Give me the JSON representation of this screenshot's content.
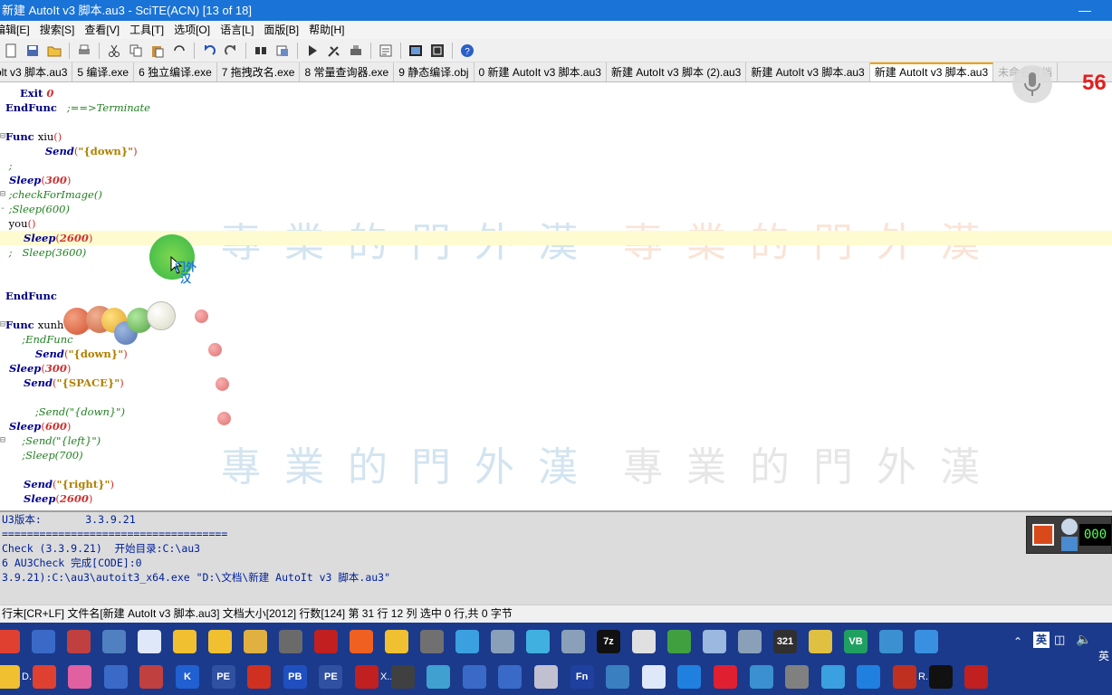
{
  "window": {
    "title": "新建 AutoIt v3 脚本.au3 - SciTE(ACN) [13 of 18]",
    "minimize_icon": "minimize-icon"
  },
  "menu": [
    "编辑[E]",
    "搜索[S]",
    "查看[V]",
    "工具[T]",
    "选项[O]",
    "语言[L]",
    "面版[B]",
    "帮助[H]"
  ],
  "toolbar_icons": [
    "new-icon",
    "save-all-icon",
    "open-icon",
    "print-icon",
    "cut-icon",
    "copy-icon",
    "paste-icon",
    "delete-icon",
    "undo-icon",
    "redo-icon",
    "find-icon",
    "replace-icon",
    "run-icon",
    "compile-icon",
    "build-icon",
    "abbrev-icon",
    "fullscreen-icon",
    "window-icon",
    "help-icon"
  ],
  "tabs": [
    {
      "label": "olt v3 脚本.au3",
      "active": false
    },
    {
      "label": "5 编译.exe",
      "active": false
    },
    {
      "label": "6 独立编译.exe",
      "active": false
    },
    {
      "label": "7 拖拽改名.exe",
      "active": false
    },
    {
      "label": "8 常量查询器.exe",
      "active": false
    },
    {
      "label": "9 静态编译.obj",
      "active": false
    },
    {
      "label": "0 新建 AutoIt v3 脚本.au3",
      "active": false
    },
    {
      "label": "新建 AutoIt v3 脚本 (2).au3",
      "active": false
    },
    {
      "label": "新建 AutoIt v3 脚本.au3",
      "active": false
    },
    {
      "label": "新建 AutoIt v3 脚本.au3",
      "active": true
    },
    {
      "label": "未命名文档",
      "active": false
    }
  ],
  "code_lines": [
    {
      "fold": "",
      "tokens": [
        {
          "c": "kw",
          "t": "    Exit "
        },
        {
          "c": "num",
          "t": "0"
        }
      ]
    },
    {
      "fold": "",
      "tokens": [
        {
          "c": "kw",
          "t": "EndFunc"
        },
        {
          "c": "cm",
          "t": "   ;==>Terminate"
        }
      ]
    },
    {
      "fold": "",
      "tokens": []
    },
    {
      "fold": "⊟",
      "tokens": [
        {
          "c": "kw",
          "t": "Func "
        },
        {
          "c": "plain",
          "t": "xiu"
        },
        {
          "c": "op",
          "t": "()"
        }
      ]
    },
    {
      "fold": "",
      "tokens": [
        {
          "c": "plain",
          "t": "            "
        },
        {
          "c": "fn",
          "t": "Send"
        },
        {
          "c": "op",
          "t": "("
        },
        {
          "c": "str",
          "t": "\"{down}\""
        },
        {
          "c": "op",
          "t": ")"
        }
      ]
    },
    {
      "fold": "",
      "tokens": [
        {
          "c": "cm",
          "t": " ;"
        }
      ]
    },
    {
      "fold": "",
      "tokens": [
        {
          "c": "fn",
          "t": " Sleep"
        },
        {
          "c": "op",
          "t": "("
        },
        {
          "c": "num",
          "t": "300"
        },
        {
          "c": "op",
          "t": ")"
        }
      ]
    },
    {
      "fold": "⊟",
      "tokens": [
        {
          "c": "cm",
          "t": " ;checkForImage()"
        }
      ]
    },
    {
      "fold": "-",
      "tokens": [
        {
          "c": "cm",
          "t": " ;Sleep(600)"
        }
      ]
    },
    {
      "fold": "",
      "tokens": [
        {
          "c": "plain",
          "t": " you"
        },
        {
          "c": "op",
          "t": "()"
        }
      ]
    },
    {
      "fold": "",
      "caret": true,
      "tokens": [
        {
          "c": "fn",
          "t": "     Sleep"
        },
        {
          "c": "op",
          "t": "("
        },
        {
          "c": "num",
          "t": "2600"
        },
        {
          "c": "op",
          "t": ")"
        }
      ]
    },
    {
      "fold": "",
      "tokens": [
        {
          "c": "cm",
          "t": " ;   Sleep(3600)"
        }
      ]
    },
    {
      "fold": "",
      "tokens": []
    },
    {
      "fold": "",
      "tokens": []
    },
    {
      "fold": "",
      "tokens": [
        {
          "c": "kw",
          "t": "EndFunc"
        }
      ]
    },
    {
      "fold": "",
      "tokens": []
    },
    {
      "fold": "⊟",
      "tokens": [
        {
          "c": "kw",
          "t": "Func "
        },
        {
          "c": "plain",
          "t": "xunhuan"
        },
        {
          "c": "op",
          "t": "()"
        }
      ]
    },
    {
      "fold": "",
      "tokens": [
        {
          "c": "cm",
          "t": "     ;EndFunc"
        }
      ]
    },
    {
      "fold": "",
      "tokens": [
        {
          "c": "plain",
          "t": "         "
        },
        {
          "c": "fn",
          "t": "Send"
        },
        {
          "c": "op",
          "t": "("
        },
        {
          "c": "str",
          "t": "\"{down}\""
        },
        {
          "c": "op",
          "t": ")"
        }
      ]
    },
    {
      "fold": "",
      "tokens": [
        {
          "c": "fn",
          "t": " Sleep"
        },
        {
          "c": "op",
          "t": "("
        },
        {
          "c": "num",
          "t": "300"
        },
        {
          "c": "op",
          "t": ")"
        }
      ]
    },
    {
      "fold": "",
      "tokens": [
        {
          "c": "fn",
          "t": "     Send"
        },
        {
          "c": "op",
          "t": "("
        },
        {
          "c": "str",
          "t": "\"{SPACE}\""
        },
        {
          "c": "op",
          "t": ")"
        }
      ]
    },
    {
      "fold": "",
      "tokens": []
    },
    {
      "fold": "",
      "tokens": [
        {
          "c": "cm",
          "t": "         ;Send(\"{down}\")"
        }
      ]
    },
    {
      "fold": "",
      "tokens": [
        {
          "c": "fn",
          "t": " Sleep"
        },
        {
          "c": "op",
          "t": "("
        },
        {
          "c": "num",
          "t": "600"
        },
        {
          "c": "op",
          "t": ")"
        }
      ]
    },
    {
      "fold": "⊟",
      "tokens": [
        {
          "c": "cm",
          "t": "     ;Send(\"{left}\")"
        }
      ]
    },
    {
      "fold": "",
      "tokens": [
        {
          "c": "cm",
          "t": "     ;Sleep(700)"
        }
      ]
    },
    {
      "fold": "",
      "tokens": []
    },
    {
      "fold": "",
      "tokens": [
        {
          "c": "fn",
          "t": "     Send"
        },
        {
          "c": "op",
          "t": "("
        },
        {
          "c": "str",
          "t": "\"{right}\""
        },
        {
          "c": "op",
          "t": ")"
        }
      ]
    },
    {
      "fold": "",
      "tokens": [
        {
          "c": "fn",
          "t": "     Sleep"
        },
        {
          "c": "op",
          "t": "("
        },
        {
          "c": "num",
          "t": "2600"
        },
        {
          "c": "op",
          "t": ")"
        }
      ]
    }
  ],
  "watermark": {
    "text": "專業的門外漢",
    "cursor_label": "门外汉"
  },
  "output_lines": [
    "U3版本:       3.3.9.21",
    "====================================",
    "Check (3.3.9.21)  开始目录:C:\\au3",
    "6 AU3Check 完成[CODE]:0",
    "3.9.21):C:\\au3\\autoit3_x64.exe \"D:\\文档\\新建 AutoIt v3 脚本.au3\""
  ],
  "status": "行末[CR+LF] 文件名[新建 AutoIt v3 脚本.au3] 文档大小[2012] 行数[124] 第 31 行 12 列 选中 0 行,共 0 字节",
  "overlay": {
    "counter": "56",
    "recorder_digits": "000"
  },
  "taskbar": {
    "top_row": [
      {
        "icon": "chrome-icon",
        "label": "",
        "color": "#e04030"
      },
      {
        "icon": "window-icon",
        "label": "",
        "color": "#3a6ac8"
      },
      {
        "icon": "app-icon",
        "label": "",
        "color": "#c04040"
      },
      {
        "icon": "edit-icon",
        "label": "",
        "color": "#5080c0"
      },
      {
        "icon": "document-icon",
        "label": "",
        "color": "#dfe8f8"
      },
      {
        "icon": "folder-icon",
        "label": "",
        "color": "#f0c030"
      },
      {
        "icon": "folder-icon",
        "label": "",
        "color": "#f0c030"
      },
      {
        "icon": "search-folder-icon",
        "label": "",
        "color": "#e0b040"
      },
      {
        "icon": "terminal-icon",
        "label": "",
        "color": "#6a6a6a"
      },
      {
        "icon": "record-icon",
        "label": "",
        "color": "#c02020"
      },
      {
        "icon": "magnifier-icon",
        "label": "",
        "color": "#f06020"
      },
      {
        "icon": "folder-icon",
        "label": "",
        "color": "#f0c030"
      },
      {
        "icon": "film-icon",
        "label": "",
        "color": "#707070"
      },
      {
        "icon": "package-icon",
        "label": "",
        "color": "#3aa0e0"
      },
      {
        "icon": "autoit-icon",
        "label": "",
        "color": "#8aa0b8"
      },
      {
        "icon": "notepad-icon",
        "label": "",
        "color": "#40b0e0"
      },
      {
        "icon": "autoit-icon",
        "label": "",
        "color": "#8aa0b8"
      },
      {
        "icon": "7zip-icon",
        "label": "7z",
        "color": "#111111"
      },
      {
        "icon": "tool-icon",
        "label": "",
        "color": "#e0e0e0"
      },
      {
        "icon": "globe-icon",
        "label": "",
        "color": "#40a040"
      },
      {
        "icon": "image-icon",
        "label": "",
        "color": "#9ab8e0"
      },
      {
        "icon": "autoit-icon",
        "label": "",
        "color": "#8aa0b8"
      },
      {
        "icon": "calendar-icon",
        "label": "321",
        "color": "#303030"
      },
      {
        "icon": "help-icon",
        "label": "",
        "color": "#e0c040"
      },
      {
        "icon": "vb-icon",
        "label": "VB",
        "color": "#20a060"
      },
      {
        "icon": "settings-icon",
        "label": "",
        "color": "#3a90d0"
      },
      {
        "icon": "check-icon",
        "label": "",
        "color": "#3a90e0"
      }
    ],
    "bottom_row": [
      {
        "icon": "folder-icon",
        "label": "D...",
        "color": "#f0c030"
      },
      {
        "icon": "chrome-icon",
        "label": "",
        "color": "#e04030"
      },
      {
        "icon": "app-icon",
        "label": "",
        "color": "#e060a0"
      },
      {
        "icon": "window-icon",
        "label": "",
        "color": "#3a6ac8"
      },
      {
        "icon": "app-icon",
        "label": "",
        "color": "#c04040"
      },
      {
        "icon": "k-icon",
        "label": "K",
        "color": "#2060d0"
      },
      {
        "icon": "pe-icon",
        "label": "PE",
        "color": "#3050a0"
      },
      {
        "icon": "app-icon",
        "label": "",
        "color": "#d03020"
      },
      {
        "icon": "pb-icon",
        "label": "PB",
        "color": "#2050c0"
      },
      {
        "icon": "pe-icon",
        "label": "PE",
        "color": "#3050a0"
      },
      {
        "icon": "record-icon",
        "label": "X...",
        "color": "#c02020"
      },
      {
        "icon": "app-icon",
        "label": "",
        "color": "#404040"
      },
      {
        "icon": "app-icon",
        "label": "",
        "color": "#40a0d0"
      },
      {
        "icon": "exe-icon",
        "label": "",
        "color": "#3a6ac8"
      },
      {
        "icon": "app-icon",
        "label": "",
        "color": "#3a6ac8"
      },
      {
        "icon": "app-icon",
        "label": "",
        "color": "#c0c0d0"
      },
      {
        "icon": "fn-icon",
        "label": "Fn",
        "color": "#2040a0"
      },
      {
        "icon": "app-icon",
        "label": "",
        "color": "#3a80c0"
      },
      {
        "icon": "document-icon",
        "label": "",
        "color": "#dfe8f8"
      },
      {
        "icon": "ie-icon",
        "label": "",
        "color": "#2080e0"
      },
      {
        "icon": "app-icon",
        "label": "",
        "color": "#e02030"
      },
      {
        "icon": "monitor-icon",
        "label": "",
        "color": "#3a90d0"
      },
      {
        "icon": "app-icon",
        "label": "",
        "color": "#808080"
      },
      {
        "icon": "cloud-icon",
        "label": "",
        "color": "#3aa0e0"
      },
      {
        "icon": "ie-icon",
        "label": "",
        "color": "#2080e0"
      },
      {
        "icon": "app-icon",
        "label": "R...",
        "color": "#c03020"
      },
      {
        "icon": "cmd-icon",
        "label": "",
        "color": "#111111"
      },
      {
        "icon": "record-icon",
        "label": "",
        "color": "#c02020"
      }
    ],
    "tray_lang": "英",
    "tray_lang_small": "英"
  }
}
